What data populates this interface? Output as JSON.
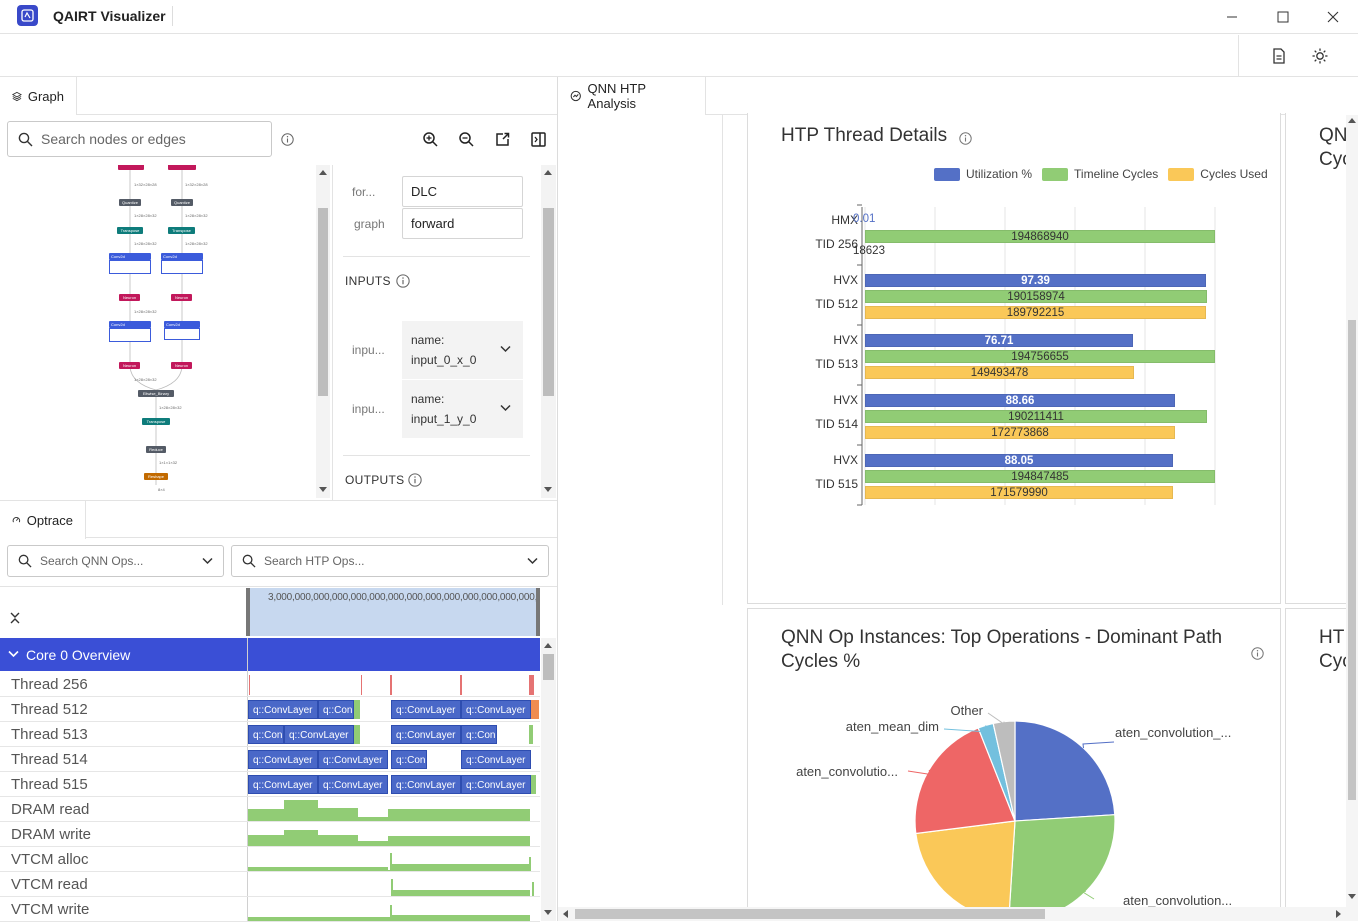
{
  "app": {
    "title": "QAIRT Visualizer"
  },
  "left_tabs": {
    "graph": "Graph",
    "optrace": "Optrace"
  },
  "graph": {
    "search_placeholder": "Search nodes or edges",
    "nodes": [
      {
        "label": "Quantize",
        "color": "#545b66"
      },
      {
        "label": "Transpose",
        "color": "#0e7c7b"
      },
      {
        "label": "Conv2d",
        "color": "#3b5bdb"
      },
      {
        "label": "Neuron",
        "color": "#c2185b"
      },
      {
        "label": "Conv2d",
        "color": "#3b5bdb"
      },
      {
        "label": "Neuron",
        "color": "#c2185b"
      },
      {
        "label": "Eltwise_Binary",
        "color": "#545b66"
      },
      {
        "label": "Transpose",
        "color": "#0e7c7b"
      },
      {
        "label": "Reduce",
        "color": "#545b66"
      },
      {
        "label": "Reshape",
        "color": "#c26a00"
      }
    ],
    "edge_labels": [
      "1×32×28×28",
      "1×32×28×28",
      "1×28×28×32",
      "1×28×28×32",
      "1×28×28×32",
      "1×28×28×32",
      "1×28×28×32",
      "1×28×28×32",
      "1×28×28×32",
      "1×1×1×32",
      "8×4"
    ]
  },
  "properties": {
    "format_label": "for...",
    "format_value": "DLC",
    "graph_label": "graph",
    "graph_value": "forward",
    "inputs_heading": "INPUTS",
    "inputs": [
      {
        "label": "inpu...",
        "name_key": "name:",
        "name_value": "input_0_x_0"
      },
      {
        "label": "inpu...",
        "name_key": "name:",
        "name_value": "input_1_y_0"
      }
    ],
    "outputs_heading": "OUTPUTS"
  },
  "optrace": {
    "qnn_search_placeholder": "Search QNN Ops...",
    "htp_search_placeholder": "Search HTP Ops...",
    "ruler_text": "3,000,0​00,000,0​00,000,000,000,000,000,000,000,000,000,000,000",
    "core_title": "Core 0 Overview",
    "rows": [
      "Thread 256",
      "Thread 512",
      "Thread 513",
      "Thread 514",
      "Thread 515",
      "DRAM read",
      "DRAM write",
      "VTCM alloc",
      "VTCM read",
      "VTCM write"
    ],
    "thread_segments": {
      "t512": [
        "q::ConvLayer",
        "q::Con",
        "q::ConvLayer",
        "q::ConvLayer"
      ],
      "t513": [
        "q::Con",
        "q::ConvLayer",
        "q::ConvLayer",
        "q::Con"
      ],
      "t514": [
        "q::ConvLayer",
        "q::ConvLayer",
        "q::Con",
        "q::ConvLayer"
      ],
      "t515": [
        "q::ConvLayer",
        "q::ConvLayer",
        "q::ConvLayer",
        "q::ConvLayer"
      ]
    }
  },
  "analysis": {
    "tab_label": "QNN HTP Analysis",
    "thread_card_title": "HTP Thread Details",
    "side_card1_title_1": "QN",
    "side_card1_title_2": "Cyc",
    "pie_card_title_1": "QNN Op Instances: Top Operations - Dominant Path",
    "pie_card_title_2": "Cycles %",
    "side_card2_title_1": "HT",
    "side_card2_title_2": "Cyc",
    "colors": {
      "util": "#5470c6",
      "timeline": "#91cc75",
      "cycles": "#fac858",
      "pie_red": "#ee6666",
      "pie_blue2": "#73c0de",
      "pie_gray": "#bdbdbd"
    }
  },
  "chart_data": [
    {
      "type": "bar",
      "title": "HTP Thread Details",
      "orientation": "horizontal",
      "categories": [
        "TID 256",
        "TID 512",
        "TID 513",
        "TID 514",
        "TID 515"
      ],
      "category_prefix": [
        "HMX",
        "HVX",
        "HVX",
        "HVX",
        "HVX"
      ],
      "series": [
        {
          "name": "Utilization %",
          "values": [
            0.01,
            97.39,
            76.71,
            88.66,
            88.05
          ],
          "labels": [
            "0.01",
            "97.39",
            "76.71",
            "88.66",
            "88.05"
          ]
        },
        {
          "name": "Timeline Cycles",
          "values": [
            194868940,
            190158974,
            194756655,
            190211411,
            194847485
          ],
          "labels": [
            "194868940",
            "190158974",
            "194756655",
            "190211411",
            "194847485"
          ]
        },
        {
          "name": "Cycles Used",
          "values": [
            18623,
            189792215,
            149493478,
            172773868,
            171579990
          ],
          "labels": [
            "18623",
            "189792215",
            "149493478",
            "172773868",
            "171579990"
          ]
        }
      ],
      "legend": "top-right",
      "grid": true
    },
    {
      "type": "pie",
      "title": "QNN Op Instances: Top Operations - Dominant Path Cycles %",
      "slices": [
        {
          "label": "aten_convolution_...",
          "value": 24,
          "color": "#5470c6"
        },
        {
          "label": "aten_convolution...",
          "value": 27,
          "color": "#91cc75"
        },
        {
          "label": "",
          "value": 22,
          "color": "#fac858"
        },
        {
          "label": "aten_convolutio...",
          "value": 21,
          "color": "#ee6666"
        },
        {
          "label": "aten_mean_dim",
          "value": 2.5,
          "color": "#73c0de"
        },
        {
          "label": "Other",
          "value": 3.5,
          "color": "#bdbdbd"
        }
      ]
    }
  ]
}
